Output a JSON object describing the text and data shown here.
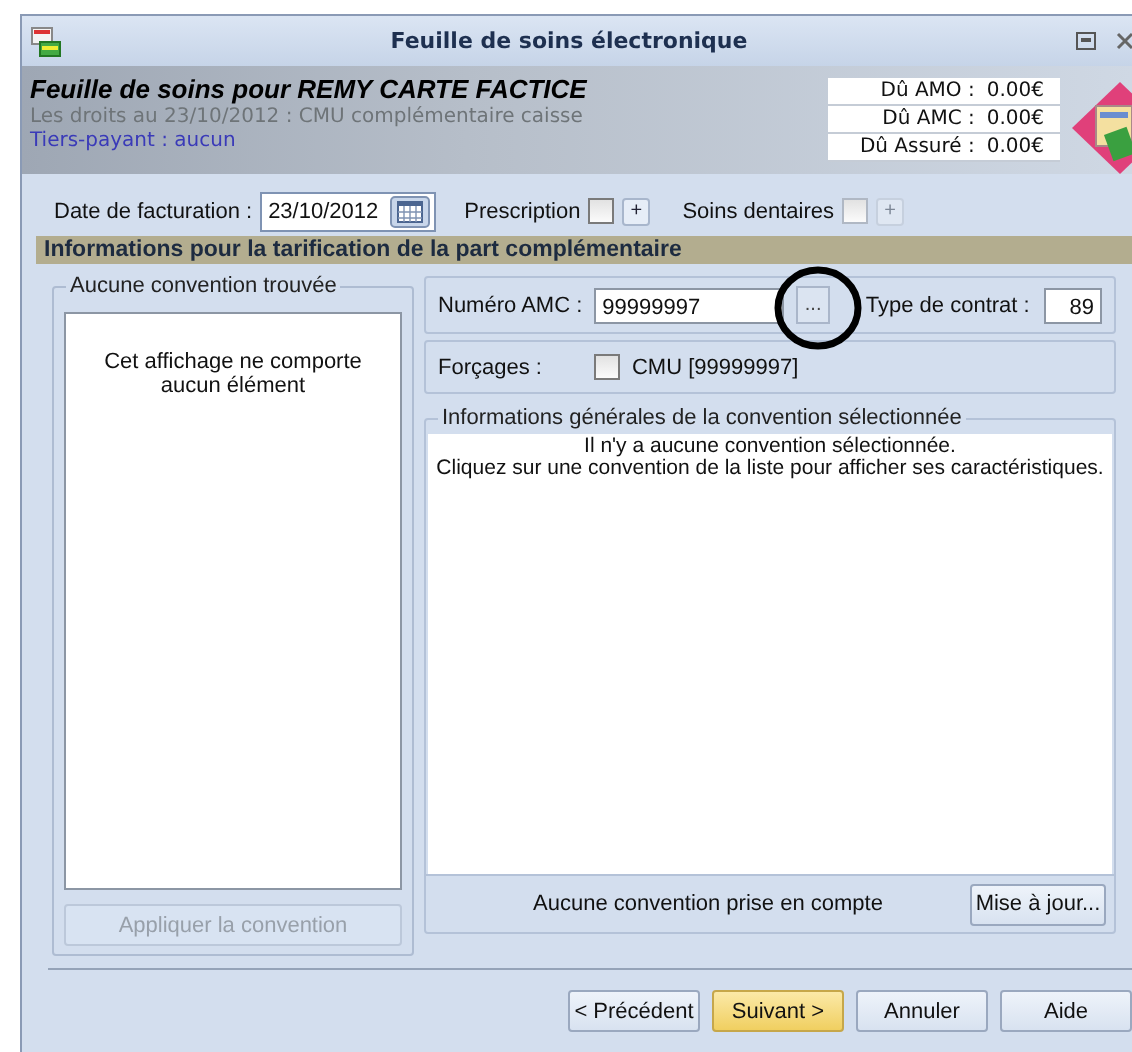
{
  "window": {
    "title": "Feuille de soins électronique"
  },
  "header": {
    "title": "Feuille de soins pour REMY CARTE FACTICE",
    "rights": "Les droits au 23/10/2012 : CMU complémentaire caisse",
    "tiers_payant": "Tiers-payant : aucun",
    "amounts": [
      {
        "label": "Dû AMO :",
        "value": "0.00€"
      },
      {
        "label": "Dû AMC :",
        "value": "0.00€"
      },
      {
        "label": "Dû Assuré :",
        "value": "0.00€"
      }
    ]
  },
  "billing": {
    "date_label": "Date de facturation :",
    "date_value": "23/10/2012",
    "options": [
      {
        "label": "Prescription",
        "checked": false,
        "disabled": false,
        "add": "+"
      },
      {
        "label": "Soins dentaires",
        "checked": false,
        "disabled": true,
        "add": "+"
      }
    ]
  },
  "section_title": "Informations pour la tarification de la part complémentaire",
  "conventions": {
    "group_title": "Aucune convention trouvée",
    "empty_message": "Cet affichage ne comporte aucun élément",
    "apply_button": {
      "label": "Appliquer la convention",
      "disabled": true
    }
  },
  "amc": {
    "label": "Numéro AMC :",
    "value": "99999997",
    "browse_button": "...",
    "contract_label": "Type de contrat :",
    "contract_value": "89"
  },
  "forcing": {
    "label": "Forçages :",
    "options": [
      {
        "label": "CMU [99999997]",
        "checked": false
      }
    ]
  },
  "details": {
    "group_title": "Informations générales de la convention sélectionnée",
    "message": [
      "Il n'y a aucune convention sélectionnée.",
      "Cliquez sur une convention de la liste pour afficher ses caractéristiques."
    ]
  },
  "status": {
    "text": "Aucune convention prise en compte",
    "update_button": "Mise à jour..."
  },
  "buttons": [
    {
      "label": "< Précédent",
      "default": false
    },
    {
      "label": "Suivant >",
      "default": true
    },
    {
      "label": "Annuler",
      "default": false
    },
    {
      "label": "Aide",
      "default": false
    }
  ]
}
